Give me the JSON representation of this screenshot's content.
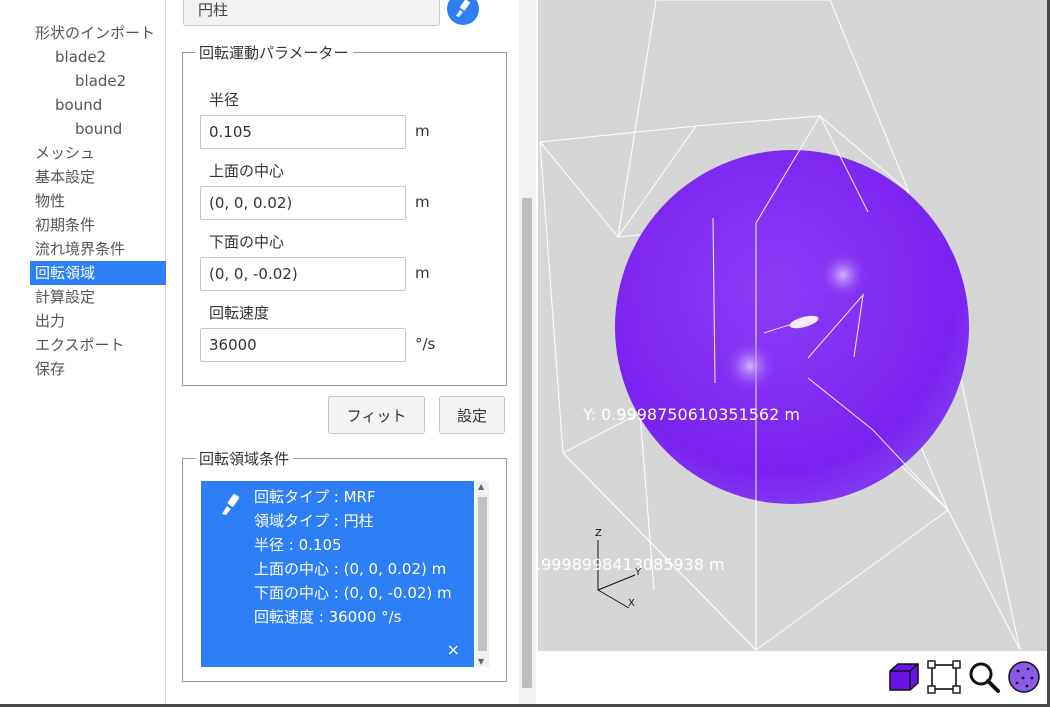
{
  "tree": {
    "items": [
      {
        "label": "形状のインポート",
        "level": 0
      },
      {
        "label": "blade2",
        "level": 1
      },
      {
        "label": "blade2",
        "level": 2
      },
      {
        "label": "bound",
        "level": 1
      },
      {
        "label": "bound",
        "level": 2
      },
      {
        "label": "メッシュ",
        "level": 0
      },
      {
        "label": "基本設定",
        "level": 0
      },
      {
        "label": "物性",
        "level": 0
      },
      {
        "label": "初期条件",
        "level": 0
      },
      {
        "label": "流れ境界条件",
        "level": 0
      },
      {
        "label": "回転領域",
        "level": 0,
        "selected": true
      },
      {
        "label": "計算設定",
        "level": 0
      },
      {
        "label": "出力",
        "level": 0
      },
      {
        "label": "エクスポート",
        "level": 0
      },
      {
        "label": "保存",
        "level": 0
      }
    ]
  },
  "shape": {
    "selected": "円柱"
  },
  "params": {
    "legend": "回転運動パラメーター",
    "radius": {
      "label": "半径",
      "value": "0.105",
      "unit": "m"
    },
    "top_center": {
      "label": "上面の中心",
      "value": "(0, 0, 0.02)",
      "unit": "m"
    },
    "bottom_center": {
      "label": "下面の中心",
      "value": "(0, 0, -0.02)",
      "unit": "m"
    },
    "speed": {
      "label": "回転速度",
      "value": "36000",
      "unit": "°/s"
    }
  },
  "buttons": {
    "fit": "フィット",
    "set": "設定"
  },
  "conditions": {
    "legend": "回転領域条件",
    "lines": [
      "回転タイプ : MRF",
      "領域タイプ : 円柱",
      "半径 : 0.105",
      "上面の中心 : (0, 0, 0.02) m",
      "下面の中心 : (0, 0, -0.02) m",
      "回転速度 : 36000 °/s"
    ],
    "close": "×"
  },
  "viewport": {
    "y_readout": "Y: 0.9998750610351562 m",
    "x_readout": ".9998998413085938 m",
    "axis_z": "Z",
    "axis_y": "Y",
    "axis_x": "X",
    "sphere_color": "#7a22f0",
    "background": "#d6d6d6"
  },
  "toolbar": {
    "icons": [
      "solid-view-icon",
      "bounding-box-icon",
      "zoom-icon",
      "mesh-points-icon"
    ]
  },
  "colors": {
    "accent": "#2e7ff5"
  }
}
